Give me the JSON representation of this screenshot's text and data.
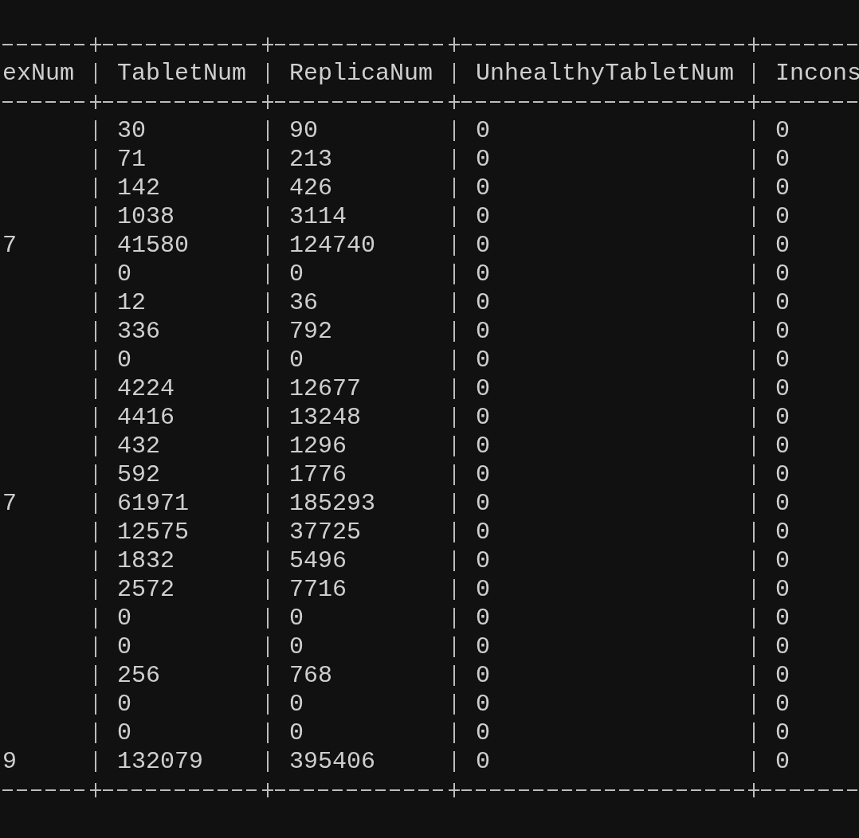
{
  "table": {
    "columns": [
      "exNum",
      "TabletNum",
      "ReplicaNum",
      "UnhealthyTabletNum",
      "Incons"
    ],
    "rows": [
      {
        "tablet_num": "30",
        "replica_num": "90",
        "unhealthy_tablet_num": "0",
        "column_5": "0"
      },
      {
        "tablet_num": "71",
        "replica_num": "213",
        "unhealthy_tablet_num": "0",
        "column_5": "0"
      },
      {
        "tablet_num": "142",
        "replica_num": "426",
        "unhealthy_tablet_num": "0",
        "column_5": "0"
      },
      {
        "tablet_num": "1038",
        "replica_num": "3114",
        "unhealthy_tablet_num": "0",
        "column_5": "0"
      },
      {
        "column_1": "7",
        "tablet_num": "41580",
        "replica_num": "124740",
        "unhealthy_tablet_num": "0",
        "column_5": "0"
      },
      {
        "tablet_num": "0",
        "replica_num": "0",
        "unhealthy_tablet_num": "0",
        "column_5": "0"
      },
      {
        "tablet_num": "12",
        "replica_num": "36",
        "unhealthy_tablet_num": "0",
        "column_5": "0"
      },
      {
        "tablet_num": "336",
        "replica_num": "792",
        "unhealthy_tablet_num": "0",
        "column_5": "0"
      },
      {
        "tablet_num": "0",
        "replica_num": "0",
        "unhealthy_tablet_num": "0",
        "column_5": "0"
      },
      {
        "tablet_num": "4224",
        "replica_num": "12677",
        "unhealthy_tablet_num": "0",
        "column_5": "0"
      },
      {
        "tablet_num": "4416",
        "replica_num": "13248",
        "unhealthy_tablet_num": "0",
        "column_5": "0"
      },
      {
        "tablet_num": "432",
        "replica_num": "1296",
        "unhealthy_tablet_num": "0",
        "column_5": "0"
      },
      {
        "tablet_num": "592",
        "replica_num": "1776",
        "unhealthy_tablet_num": "0",
        "column_5": "0"
      },
      {
        "column_1": "7",
        "tablet_num": "61971",
        "replica_num": "185293",
        "unhealthy_tablet_num": "0",
        "column_5": "0"
      },
      {
        "tablet_num": "12575",
        "replica_num": "37725",
        "unhealthy_tablet_num": "0",
        "column_5": "0"
      },
      {
        "tablet_num": "1832",
        "replica_num": "5496",
        "unhealthy_tablet_num": "0",
        "column_5": "0"
      },
      {
        "tablet_num": "2572",
        "replica_num": "7716",
        "unhealthy_tablet_num": "0",
        "column_5": "0"
      },
      {
        "tablet_num": "0",
        "replica_num": "0",
        "unhealthy_tablet_num": "0",
        "column_5": "0"
      },
      {
        "tablet_num": "0",
        "replica_num": "0",
        "unhealthy_tablet_num": "0",
        "column_5": "0"
      },
      {
        "tablet_num": "256",
        "replica_num": "768",
        "unhealthy_tablet_num": "0",
        "column_5": "0"
      },
      {
        "tablet_num": "0",
        "replica_num": "0",
        "unhealthy_tablet_num": "0",
        "column_5": "0"
      },
      {
        "tablet_num": "0",
        "replica_num": "0",
        "unhealthy_tablet_num": "0",
        "column_5": "0"
      },
      {
        "column_1": "9",
        "tablet_num": "132079",
        "replica_num": "395406",
        "unhealthy_tablet_num": "0",
        "column_5": "0"
      }
    ]
  }
}
